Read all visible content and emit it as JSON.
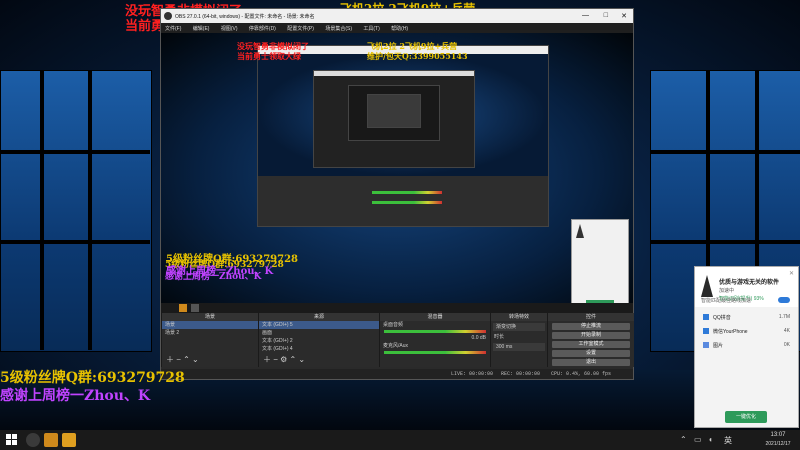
{
  "overlay": {
    "topleft_line1": "没玩智勇非模拟闭了",
    "topleft_line2": "当前勇士领取大绿",
    "topright_line1": "飞机2拉 2飞机9拉+兵营",
    "topright_line2": "维护/包天Q:3399055143",
    "mid_fan": "5级粉丝牌Q群:693279728",
    "mid_thanks": "感谢上周榜一Zhou、K",
    "big_fan": "5级粉丝牌Q群:693279728",
    "big_thanks": "感谢上周榜一Zhou、K",
    "accent_yellow": "#e8c200",
    "accent_red": "#ff2020",
    "accent_purple": "#c043ff"
  },
  "obs": {
    "title": "OBS 27.0.1 (64-bit, windows) - 配置文件: 未命名 - 场景: 未命名",
    "window_controls": [
      "—",
      "□",
      "✕"
    ],
    "menus": [
      "文件(F)",
      "编辑(E)",
      "视图(V)",
      "停靠部件(D)",
      "配置文件(P)",
      "场景集合(S)",
      "工具(T)",
      "帮助(H)"
    ],
    "docks": {
      "scenes": {
        "header": "场景",
        "items": [
          "场景",
          "场景 2"
        ]
      },
      "sources": {
        "header": "来源",
        "items": [
          "文本 (GDI+) 5",
          "画面",
          "文本 (GDI+) 2",
          "文本 (GDI+) 4"
        ]
      },
      "mixer": {
        "header": "混音器",
        "tracks": [
          {
            "name": "桌面音频",
            "db": "0.0 dB"
          },
          {
            "name": "麦克风/Aux",
            "db": "0.0 dB"
          }
        ]
      },
      "transitions": {
        "header": "转场特效",
        "type": "渐变切换",
        "duration_label": "时长",
        "duration": "300 ms"
      },
      "controls": {
        "header": "控件",
        "buttons": [
          "停止推流",
          "开始录制",
          "工作室模式",
          "设置",
          "退出"
        ]
      }
    },
    "status": {
      "live": "LIVE: 00:00:00",
      "rec": "REC: 00:00:00",
      "cpu": "CPU: 0.4%, 60.00 fps"
    }
  },
  "popup": {
    "title": "优质与游戏无关的软件",
    "subtitle": "加速中",
    "speed_label": "智能识别(提升) 93%",
    "toggle_label": "智能匹配最佳路线加速",
    "items": [
      {
        "name": "QQ拼音",
        "value": "1.7M"
      },
      {
        "name": "微信YourPhone",
        "value": "4K"
      },
      {
        "name": "图片",
        "value": "0K"
      }
    ],
    "button": "一键优化"
  },
  "taskbar": {
    "time": "13:07",
    "date": "2021/12/17",
    "tray_text": "英",
    "start_icon": "windows-logo-icon"
  }
}
